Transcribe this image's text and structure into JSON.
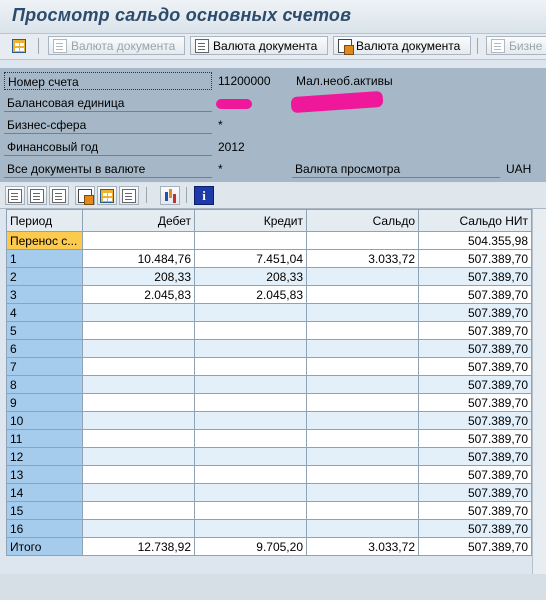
{
  "title": "Просмотр сальдо основных счетов",
  "toolbar": {
    "btn1": "Валюта документа",
    "btn2": "Валюта документа",
    "btn3": "Валюта документа",
    "btn4": "Бизне"
  },
  "header": {
    "account_label": "Номер счета",
    "account_value": "11200000",
    "account_text": "Мал.необ.активы",
    "company_label": "Балансовая единица",
    "business_area_label": "Бизнес-сфера",
    "business_area_value": "*",
    "fiscal_year_label": "Финансовый год",
    "fiscal_year_value": "2012",
    "all_docs_label": "Все документы в валюте",
    "all_docs_value": "*",
    "display_currency_label": "Валюта просмотра",
    "display_currency_value": "UAH"
  },
  "table": {
    "columns": [
      "Период",
      "Дебет",
      "Кредит",
      "Сальдо",
      "Сальдо НИт"
    ],
    "rows": [
      {
        "period": "Перенос с...",
        "debit": "",
        "credit": "",
        "balance": "",
        "cumulative": "504.355,98"
      },
      {
        "period": "1",
        "debit": "10.484,76",
        "credit": "7.451,04",
        "balance": "3.033,72",
        "cumulative": "507.389,70"
      },
      {
        "period": "2",
        "debit": "208,33",
        "credit": "208,33",
        "balance": "",
        "cumulative": "507.389,70"
      },
      {
        "period": "3",
        "debit": "2.045,83",
        "credit": "2.045,83",
        "balance": "",
        "cumulative": "507.389,70"
      },
      {
        "period": "4",
        "debit": "",
        "credit": "",
        "balance": "",
        "cumulative": "507.389,70"
      },
      {
        "period": "5",
        "debit": "",
        "credit": "",
        "balance": "",
        "cumulative": "507.389,70"
      },
      {
        "period": "6",
        "debit": "",
        "credit": "",
        "balance": "",
        "cumulative": "507.389,70"
      },
      {
        "period": "7",
        "debit": "",
        "credit": "",
        "balance": "",
        "cumulative": "507.389,70"
      },
      {
        "period": "8",
        "debit": "",
        "credit": "",
        "balance": "",
        "cumulative": "507.389,70"
      },
      {
        "period": "9",
        "debit": "",
        "credit": "",
        "balance": "",
        "cumulative": "507.389,70"
      },
      {
        "period": "10",
        "debit": "",
        "credit": "",
        "balance": "",
        "cumulative": "507.389,70"
      },
      {
        "period": "11",
        "debit": "",
        "credit": "",
        "balance": "",
        "cumulative": "507.389,70"
      },
      {
        "period": "12",
        "debit": "",
        "credit": "",
        "balance": "",
        "cumulative": "507.389,70"
      },
      {
        "period": "13",
        "debit": "",
        "credit": "",
        "balance": "",
        "cumulative": "507.389,70"
      },
      {
        "period": "14",
        "debit": "",
        "credit": "",
        "balance": "",
        "cumulative": "507.389,70"
      },
      {
        "period": "15",
        "debit": "",
        "credit": "",
        "balance": "",
        "cumulative": "507.389,70"
      },
      {
        "period": "16",
        "debit": "",
        "credit": "",
        "balance": "",
        "cumulative": "507.389,70"
      },
      {
        "period": "Итого",
        "debit": "12.738,92",
        "credit": "9.705,20",
        "balance": "3.033,72",
        "cumulative": "507.389,70"
      }
    ]
  },
  "colors": {
    "header_bg": "#a6b8c8",
    "period_cell": "#a5cbed",
    "carry_forward_cell": "#fcca4c",
    "redaction": "#f0189a"
  }
}
